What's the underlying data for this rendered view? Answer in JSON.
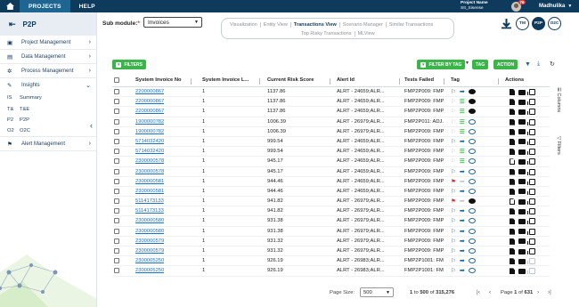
{
  "topbar": {
    "tabs": [
      {
        "label": "PROJECTS"
      },
      {
        "label": "HELP"
      }
    ],
    "project_name_label": "Project Name",
    "project_name_value": "SIt_Sisense",
    "notification_count": "76",
    "user_name": "Madhulika"
  },
  "sidebar": {
    "title": "P2P",
    "items": [
      {
        "label": "Project Management"
      },
      {
        "label": "Data Management"
      },
      {
        "label": "Process Management"
      },
      {
        "label": "Insights"
      },
      {
        "label": "Alert Management"
      }
    ],
    "insight_subs": [
      {
        "code": "IS",
        "label": "Summary"
      },
      {
        "code": "T&",
        "label": "T&E"
      },
      {
        "code": "P2",
        "label": "P2P"
      },
      {
        "code": "O2",
        "label": "O2C"
      }
    ]
  },
  "submodule": {
    "label": "Sub module:",
    "required_mark": "*",
    "value": "Invoices"
  },
  "view_tabs": {
    "row1": [
      "Visualization",
      "Entity View",
      "Transactions View",
      "Scenario Manager",
      "Similar Transactions"
    ],
    "row2": [
      "Top Risky Transactions",
      "MLView"
    ],
    "active": "Transactions View"
  },
  "circle_buttons": [
    "TM",
    "P2P",
    "O2C"
  ],
  "toolbar": {
    "filters_label": "FILTERS",
    "filter_by_tag_label": "FILTER BY TAG",
    "tag_label": "TAG",
    "action_label": "ACTION"
  },
  "grid": {
    "headers": [
      "System Invoice No",
      "System Invoice L...",
      "Current Risk Score",
      "Alert Id",
      "Tests Failed",
      "Tag",
      "Actions"
    ],
    "rows": [
      {
        "invoice": "2200000867",
        "line": "1",
        "score": "1137.86",
        "alert": "ALRT - 24659;ALR...",
        "tests": "FMP2P009: FMP2...",
        "flag": "blue",
        "arrow": true,
        "list": false,
        "bubble": "dark",
        "doc": "fill",
        "copy": "on"
      },
      {
        "invoice": "2200000867",
        "line": "1",
        "score": "1137.86",
        "alert": "ALRT - 24659;ALR...",
        "tests": "FMP2P009: FMP2...",
        "flag": "none",
        "arrow": false,
        "list": true,
        "bubble": "dark",
        "doc": "fill",
        "copy": "on"
      },
      {
        "invoice": "2200000867",
        "line": "1",
        "score": "1137.86",
        "alert": "ALRT - 24659;ALR...",
        "tests": "FMP2P009: FMP2...",
        "flag": "none",
        "arrow": false,
        "list": true,
        "bubble": "dark",
        "doc": "fill",
        "copy": "on"
      },
      {
        "invoice": "1900000782",
        "line": "1",
        "score": "1006.39",
        "alert": "ALRT - 26979;ALR...",
        "tests": "FMP2P011: ADJ...",
        "flag": "none",
        "arrow": false,
        "list": true,
        "bubble": "blue",
        "doc": "fill",
        "copy": "on"
      },
      {
        "invoice": "1900000782",
        "line": "1",
        "score": "1006.39",
        "alert": "ALRT - 26979;ALR...",
        "tests": "FMP2P009: FMP2...",
        "flag": "none",
        "arrow": false,
        "list": true,
        "bubble": "blue",
        "doc": "fill",
        "copy": "on"
      },
      {
        "invoice": "5714032420",
        "line": "1",
        "score": "999.54",
        "alert": "ALRT - 24659;ALR...",
        "tests": "FMP2P009: FMP2...",
        "flag": "blue",
        "arrow": true,
        "list": false,
        "bubble": "blue",
        "doc": "fill",
        "copy": "on"
      },
      {
        "invoice": "5714032420",
        "line": "1",
        "score": "999.54",
        "alert": "ALRT - 24659;ALR...",
        "tests": "FMP2P009: FMP2...",
        "flag": "none",
        "arrow": false,
        "list": true,
        "bubble": "blue",
        "doc": "fill",
        "copy": "on"
      },
      {
        "invoice": "2300000578",
        "line": "1",
        "score": "945.17",
        "alert": "ALRT - 24659;ALR...",
        "tests": "FMP2P009: FMP2...",
        "flag": "none",
        "arrow": false,
        "list": true,
        "bubble": "blue",
        "doc": "out",
        "copy": "on"
      },
      {
        "invoice": "2300000578",
        "line": "1",
        "score": "945.17",
        "alert": "ALRT - 24659;ALR...",
        "tests": "FMP2P009: FMP2...",
        "flag": "blue",
        "arrow": true,
        "list": false,
        "bubble": "blue",
        "doc": "fill",
        "copy": "on"
      },
      {
        "invoice": "2300000581",
        "line": "1",
        "score": "944.46",
        "alert": "ALRT - 24659;ALR...",
        "tests": "FMP2P009: FMP2...",
        "flag": "red",
        "arrow": false,
        "list": false,
        "bubble": "blue",
        "doc": "fill",
        "copy": "on"
      },
      {
        "invoice": "2300000581",
        "line": "1",
        "score": "944.46",
        "alert": "ALRT - 24659;ALR...",
        "tests": "FMP2P009: FMP2...",
        "flag": "blue",
        "arrow": true,
        "list": false,
        "bubble": "blue",
        "doc": "fill",
        "copy": "on"
      },
      {
        "invoice": "5114173133",
        "line": "1",
        "score": "941.82",
        "alert": "ALRT - 26979;ALR...",
        "tests": "FMP2P009: FMP2...",
        "flag": "red",
        "arrow": false,
        "list": false,
        "bubble": "dark",
        "doc": "out",
        "copy": "on"
      },
      {
        "invoice": "5114173133",
        "line": "1",
        "score": "941.82",
        "alert": "ALRT - 26979;ALR...",
        "tests": "FMP2P009: FMP2...",
        "flag": "blue",
        "arrow": true,
        "list": false,
        "bubble": "blue",
        "doc": "fill",
        "copy": "on"
      },
      {
        "invoice": "2300000580",
        "line": "1",
        "score": "931.38",
        "alert": "ALRT - 26979;ALR...",
        "tests": "FMP2P009: FMP2...",
        "flag": "blue",
        "arrow": true,
        "list": false,
        "bubble": "blue",
        "doc": "fill",
        "copy": "on"
      },
      {
        "invoice": "2300000580",
        "line": "1",
        "score": "931.38",
        "alert": "ALRT - 26979;ALR...",
        "tests": "FMP2P009: FMP2...",
        "flag": "blue",
        "arrow": true,
        "list": false,
        "bubble": "blue",
        "doc": "fill",
        "copy": "on"
      },
      {
        "invoice": "2300000579",
        "line": "1",
        "score": "931.32",
        "alert": "ALRT - 26979;ALR...",
        "tests": "FMP2P009: FMP2...",
        "flag": "blue",
        "arrow": true,
        "list": false,
        "bubble": "blue",
        "doc": "fill",
        "copy": "on"
      },
      {
        "invoice": "2300000579",
        "line": "1",
        "score": "931.32",
        "alert": "ALRT - 26979;ALR...",
        "tests": "FMP2P009: FMP2...",
        "flag": "blue",
        "arrow": true,
        "list": false,
        "bubble": "blue",
        "doc": "fill",
        "copy": "on"
      },
      {
        "invoice": "2300005250",
        "line": "1",
        "score": "926.19",
        "alert": "ALRT - 26983;ALR...",
        "tests": "FMP2P1001: FMP2...",
        "flag": "blue",
        "arrow": true,
        "list": false,
        "bubble": "blue",
        "doc": "fill",
        "copy": "off"
      },
      {
        "invoice": "2300005250",
        "line": "1",
        "score": "926.19",
        "alert": "ALRT - 26983;ALR...",
        "tests": "FMP2P1001: FMP2...",
        "flag": "blue",
        "arrow": true,
        "list": false,
        "bubble": "blue",
        "doc": "fill",
        "copy": "off"
      }
    ]
  },
  "side_panel": [
    "Columns",
    "Filters"
  ],
  "footer": {
    "page_size_label": "Page Size:",
    "page_size_value": "500",
    "range_from": "1",
    "range_to_word": "to",
    "range_to": "500",
    "range_of_word": "of",
    "total": "315,276",
    "page_word": "Page",
    "page": "1",
    "page_of_word": "of",
    "page_total": "631"
  },
  "colors": {
    "navy": "#0e3a5c",
    "green": "#3bb54a",
    "link": "#1a73c4"
  }
}
